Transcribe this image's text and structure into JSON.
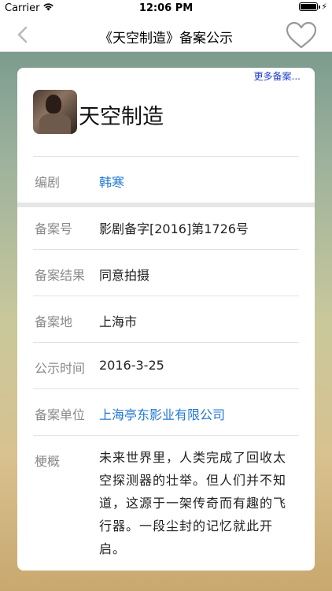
{
  "status": {
    "carrier": "Carrier",
    "time": "12:06 PM"
  },
  "nav": {
    "title": "《天空制造》备案公示"
  },
  "card": {
    "more_link": "更多备案...",
    "movie_title": "天空制造",
    "screenwriter": {
      "label": "编剧",
      "value": "韩寒"
    },
    "rows": [
      {
        "label": "备案号",
        "value": "影剧备字[2016]第1726号"
      },
      {
        "label": "备案结果",
        "value": "同意拍摄"
      },
      {
        "label": "备案地",
        "value": "上海市"
      },
      {
        "label": "公示时间",
        "value": "2016-3-25"
      },
      {
        "label": "备案单位",
        "value": "上海亭东影业有限公司"
      }
    ],
    "summary": {
      "label": "梗概",
      "value": "未来世界里，人类完成了回收太空探测器的壮举。但人们并不知道，这源于一架传奇而有趣的飞行器。一段尘封的记忆就此开启。"
    }
  },
  "colors": {
    "link": "#2178d4",
    "more_link": "#1f3fd0",
    "label": "#8a8a8a"
  }
}
